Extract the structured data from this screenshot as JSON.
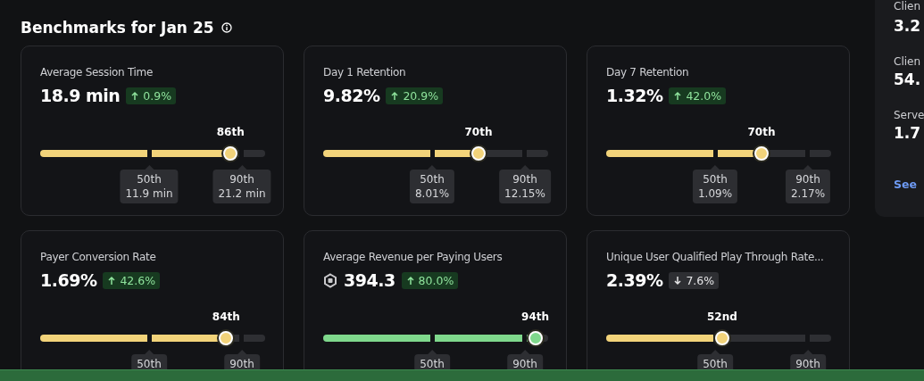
{
  "title": "Benchmarks for Jan 25",
  "cards": [
    {
      "title": "Average Session Time",
      "value": "18.9 min",
      "delta": {
        "kind": "up",
        "text": "0.9%"
      },
      "percentile": "86th",
      "level": 0.86,
      "color": "#f2d37a",
      "p50": {
        "label": "50th",
        "value": "11.9 min"
      },
      "p90": {
        "label": "90th",
        "value": "21.2 min"
      }
    },
    {
      "title": "Day 1 Retention",
      "value": "9.82%",
      "delta": {
        "kind": "up",
        "text": "20.9%"
      },
      "percentile": "70th",
      "level": 0.7,
      "color": "#f2d37a",
      "p50": {
        "label": "50th",
        "value": "8.01%"
      },
      "p90": {
        "label": "90th",
        "value": "12.15%"
      }
    },
    {
      "title": "Day 7 Retention",
      "value": "1.32%",
      "delta": {
        "kind": "up",
        "text": "42.0%"
      },
      "percentile": "70th",
      "level": 0.7,
      "color": "#f2d37a",
      "p50": {
        "label": "50th",
        "value": "1.09%"
      },
      "p90": {
        "label": "90th",
        "value": "2.17%"
      }
    },
    {
      "title": "Payer Conversion Rate",
      "value": "1.69%",
      "delta": {
        "kind": "up",
        "text": "42.6%"
      },
      "percentile": "84th",
      "level": 0.84,
      "color": "#f2d37a",
      "p50": {
        "label": "50th"
      },
      "p90": {
        "label": "90th"
      }
    },
    {
      "title": "Average Revenue per Paying Users",
      "currency_icon": true,
      "value": "394.3",
      "delta": {
        "kind": "up",
        "text": "80.0%"
      },
      "percentile": "94th",
      "level": 0.94,
      "color": "#7fd88c",
      "p50": {
        "label": "50th"
      },
      "p90": {
        "label": "90th"
      }
    },
    {
      "title": "Unique User Qualified Play Through Rate...",
      "value": "2.39%",
      "delta": {
        "kind": "down",
        "text": "7.6%"
      },
      "percentile": "52nd",
      "level": 0.52,
      "color": "#f2d37a",
      "p50": {
        "label": "50th"
      },
      "p90": {
        "label": "90th"
      }
    }
  ],
  "side_panel": {
    "stats": [
      {
        "label": "Clien",
        "value": "3.2"
      },
      {
        "label": "Clien",
        "value": "54."
      },
      {
        "label": "Serve",
        "value": "1.7"
      }
    ],
    "link": "See"
  }
}
